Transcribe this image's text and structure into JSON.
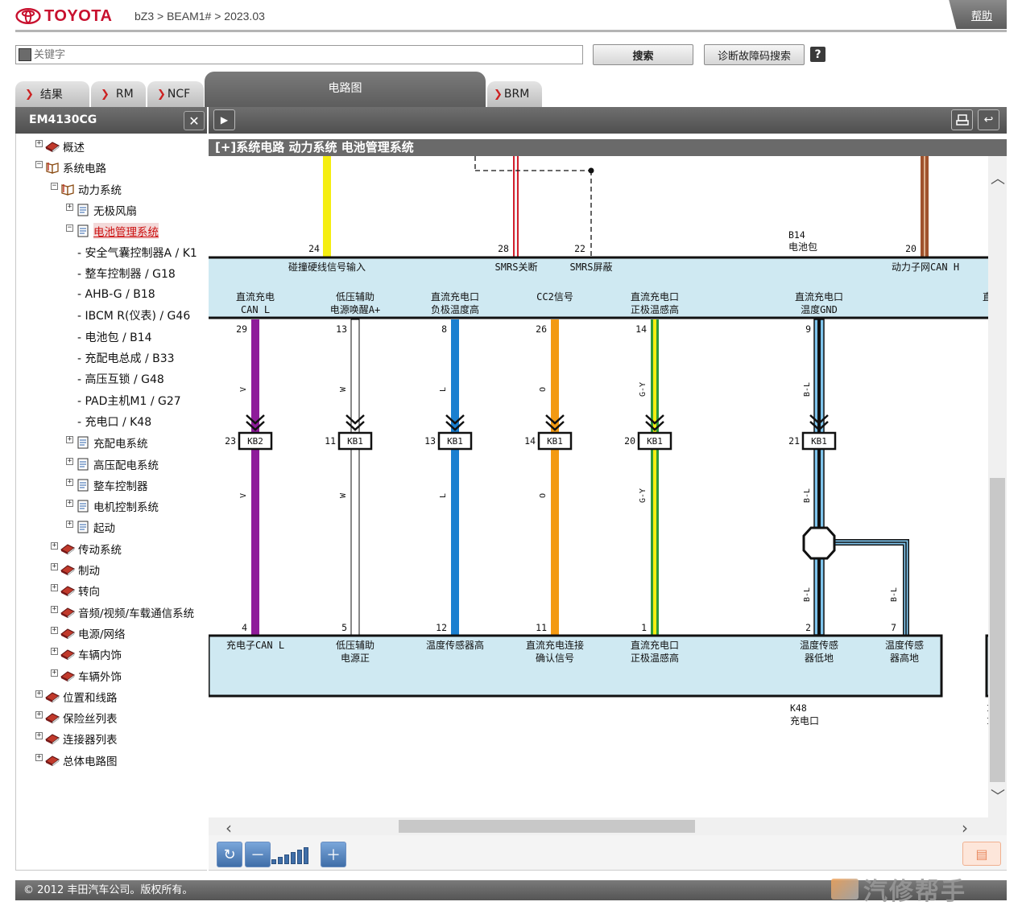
{
  "header": {
    "brand": "TOYOTA",
    "breadcrumb": "bZ3 > BEAM1# > 2023.03",
    "help": "帮助"
  },
  "search": {
    "placeholder": "关键字",
    "search_label": "搜索",
    "dtc_label": "诊断故障码搜索",
    "help_icon": "?"
  },
  "tabs": {
    "results": "结果",
    "rm": "RM",
    "ncf": "NCF",
    "wiring": "电路图",
    "brm": "BRM"
  },
  "left": {
    "title": "EM4130CG",
    "tree": [
      {
        "label": "概述",
        "pm": "+",
        "icon": "book-closed-icon"
      },
      {
        "label": "系统电路",
        "pm": "−",
        "icon": "book-open-icon"
      },
      {
        "label": "动力系统",
        "pm": "−",
        "icon": "book-open-icon"
      },
      {
        "label": "无极风扇",
        "pm": "+",
        "icon": "document-icon"
      },
      {
        "label": "电池管理系统",
        "pm": "−",
        "icon": "document-icon"
      },
      {
        "label": "- 安全气囊控制器A / K1"
      },
      {
        "label": "- 整车控制器 / G18"
      },
      {
        "label": "- AHB-G / B18"
      },
      {
        "label": "- IBCM R(仪表) / G46"
      },
      {
        "label": "- 电池包 / B14"
      },
      {
        "label": "- 充配电总成 / B33"
      },
      {
        "label": "- 高压互锁 / G48"
      },
      {
        "label": "- PAD主机M1 / G27"
      },
      {
        "label": "- 充电口 / K48"
      },
      {
        "label": "充配电系统",
        "pm": "+",
        "icon": "document-icon"
      },
      {
        "label": "高压配电系统",
        "pm": "+",
        "icon": "document-icon"
      },
      {
        "label": "整车控制器",
        "pm": "+",
        "icon": "document-icon"
      },
      {
        "label": "电机控制系统",
        "pm": "+",
        "icon": "document-icon"
      },
      {
        "label": "起动",
        "pm": "+",
        "icon": "document-icon"
      },
      {
        "label": "传动系统",
        "pm": "+",
        "icon": "book-closed-icon"
      },
      {
        "label": "制动",
        "pm": "+",
        "icon": "book-closed-icon"
      },
      {
        "label": "转向",
        "pm": "+",
        "icon": "book-closed-icon"
      },
      {
        "label": "音频/视频/车载通信系统",
        "pm": "+",
        "icon": "book-closed-icon"
      },
      {
        "label": "电源/网络",
        "pm": "+",
        "icon": "book-closed-icon"
      },
      {
        "label": "车辆内饰",
        "pm": "+",
        "icon": "book-closed-icon"
      },
      {
        "label": "车辆外饰",
        "pm": "+",
        "icon": "book-closed-icon"
      },
      {
        "label": "位置和线路",
        "pm": "+",
        "icon": "book-closed-icon"
      },
      {
        "label": "保险丝列表",
        "pm": "+",
        "icon": "book-closed-icon"
      },
      {
        "label": "连接器列表",
        "pm": "+",
        "icon": "book-closed-icon"
      },
      {
        "label": "总体电路图",
        "pm": "+",
        "icon": "book-closed-icon"
      }
    ]
  },
  "diagram": {
    "title": "[+]系统电路  动力系统  电池管理系统",
    "upper_connector": {
      "code": "B14",
      "name": "电池包",
      "pins": [
        "24",
        "28",
        "22",
        "20"
      ],
      "labels": [
        "碰撞硬线信号输入",
        "SMRS关断",
        "SMRS屏蔽",
        "动力子网CAN H"
      ]
    },
    "mid_labels": [
      [
        "直流充电",
        "CAN L"
      ],
      [
        "低压辅助",
        "电源唤醒A+"
      ],
      [
        "直流充电口",
        "负极温度高"
      ],
      [
        "CC2信号",
        ""
      ],
      [
        "直流充电口",
        "正极温感高"
      ],
      [
        "直流充电口",
        "温度GND"
      ]
    ],
    "mid_edge_char": "直",
    "wires": [
      {
        "top_pin": "29",
        "color_code": "V",
        "joint_pin": "23",
        "joint": "KB2",
        "bottom_pin": "4",
        "color": "#8e1b9a"
      },
      {
        "top_pin": "13",
        "color_code": "W",
        "joint_pin": "11",
        "joint": "KB1",
        "bottom_pin": "5",
        "color": "#ffffff"
      },
      {
        "top_pin": "8",
        "color_code": "L",
        "joint_pin": "13",
        "joint": "KB1",
        "bottom_pin": "12",
        "color": "#1a7fd0"
      },
      {
        "top_pin": "26",
        "color_code": "O",
        "joint_pin": "14",
        "joint": "KB1",
        "bottom_pin": "11",
        "color": "#f39a12"
      },
      {
        "top_pin": "14",
        "color_code": "G-Y",
        "joint_pin": "20",
        "joint": "KB1",
        "bottom_pin": "1",
        "color": "#2e9a3a"
      },
      {
        "top_pin": "9",
        "color_code": "B-L",
        "joint_pin": "21",
        "joint": "KB1",
        "bottom_pin": "2",
        "color": "#111111"
      }
    ],
    "branch_wire": {
      "color_code": "B-L",
      "bottom_pin": "7"
    },
    "bottom_connector": {
      "code": "K48",
      "name": "充电口",
      "labels": [
        [
          "充电子CAN L",
          ""
        ],
        [
          "低压辅助",
          "电源正"
        ],
        [
          "温度传感器高",
          ""
        ],
        [
          "直流充电连接",
          "确认信号"
        ],
        [
          "直流充电口",
          "正极温感高"
        ],
        [
          "温度传感",
          "器低地"
        ],
        [
          "温度传感",
          "器高地"
        ]
      ]
    },
    "right_edge_chars": [
      "I",
      "I"
    ]
  },
  "colors": {
    "connector_fill": "#cfe9f2",
    "wire_yellow": "#f5ee10",
    "wire_red": "#d11f2c",
    "wire_brown": "#a0522d",
    "wire_blue_light": "#7fc4ec"
  },
  "footer": {
    "copyright": "© 2012 丰田汽车公司。版权所有。",
    "watermark": "汽修帮手"
  }
}
